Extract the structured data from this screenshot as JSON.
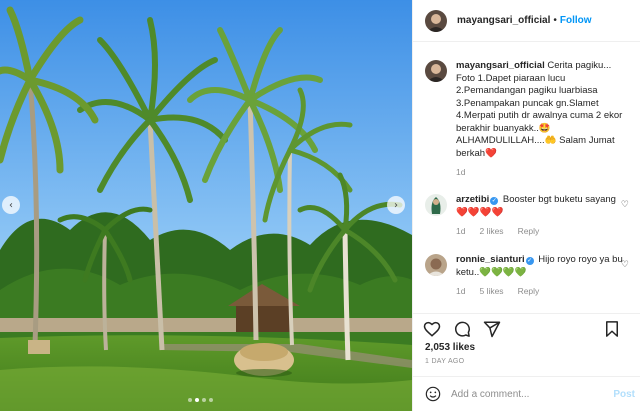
{
  "post": {
    "author": "mayangsari_official",
    "header_separator": "•",
    "follow_label": "Follow",
    "photo_alt": "Garden with tall coconut palm trees, green lawn, gazebo and a round wicker chair",
    "carousel": {
      "slides": 4,
      "active_slide": 2
    },
    "prev_icon": "chevron-left-icon",
    "next_icon": "chevron-right-icon"
  },
  "caption": {
    "user": "mayangsari_official",
    "text": "Cerita pagiku... Foto 1.Dapet piaraan lucu 2.Pemandangan pagiku luarbiasa 3.Penampakan puncak gn.Slamet 4.Merpati putih dr awalnya cuma 2 ekor berakhir buanyakk..🤩 ALHAMDULILLAH....🤲 Salam Jumat berkah❤️",
    "time": "1d"
  },
  "comments": [
    {
      "user": "arzetibi",
      "verified": true,
      "text": "Booster bgt buketu sayang ❤️❤️❤️❤️",
      "time": "1d",
      "likes": "2 likes",
      "reply": "Reply"
    },
    {
      "user": "ronnie_sianturi",
      "verified": true,
      "text": "Hijo royo royo ya bu ketu..💚💚💚💚",
      "time": "1d",
      "likes": "5 likes",
      "reply": "Reply"
    }
  ],
  "actions": {
    "like_icon": "heart-icon",
    "comment_icon": "comment-icon",
    "share_icon": "paper-plane-icon",
    "save_icon": "bookmark-icon"
  },
  "likes": "2,053 likes",
  "time_ago": "1 DAY AGO",
  "add_comment": {
    "placeholder": "Add a comment...",
    "post_label": "Post",
    "emoji_icon": "smiley-icon"
  },
  "colors": {
    "link_blue": "#0095f6",
    "post_disabled": "#b2dffc",
    "heart_red": "#ed4956",
    "muted": "#8e8e8e"
  }
}
